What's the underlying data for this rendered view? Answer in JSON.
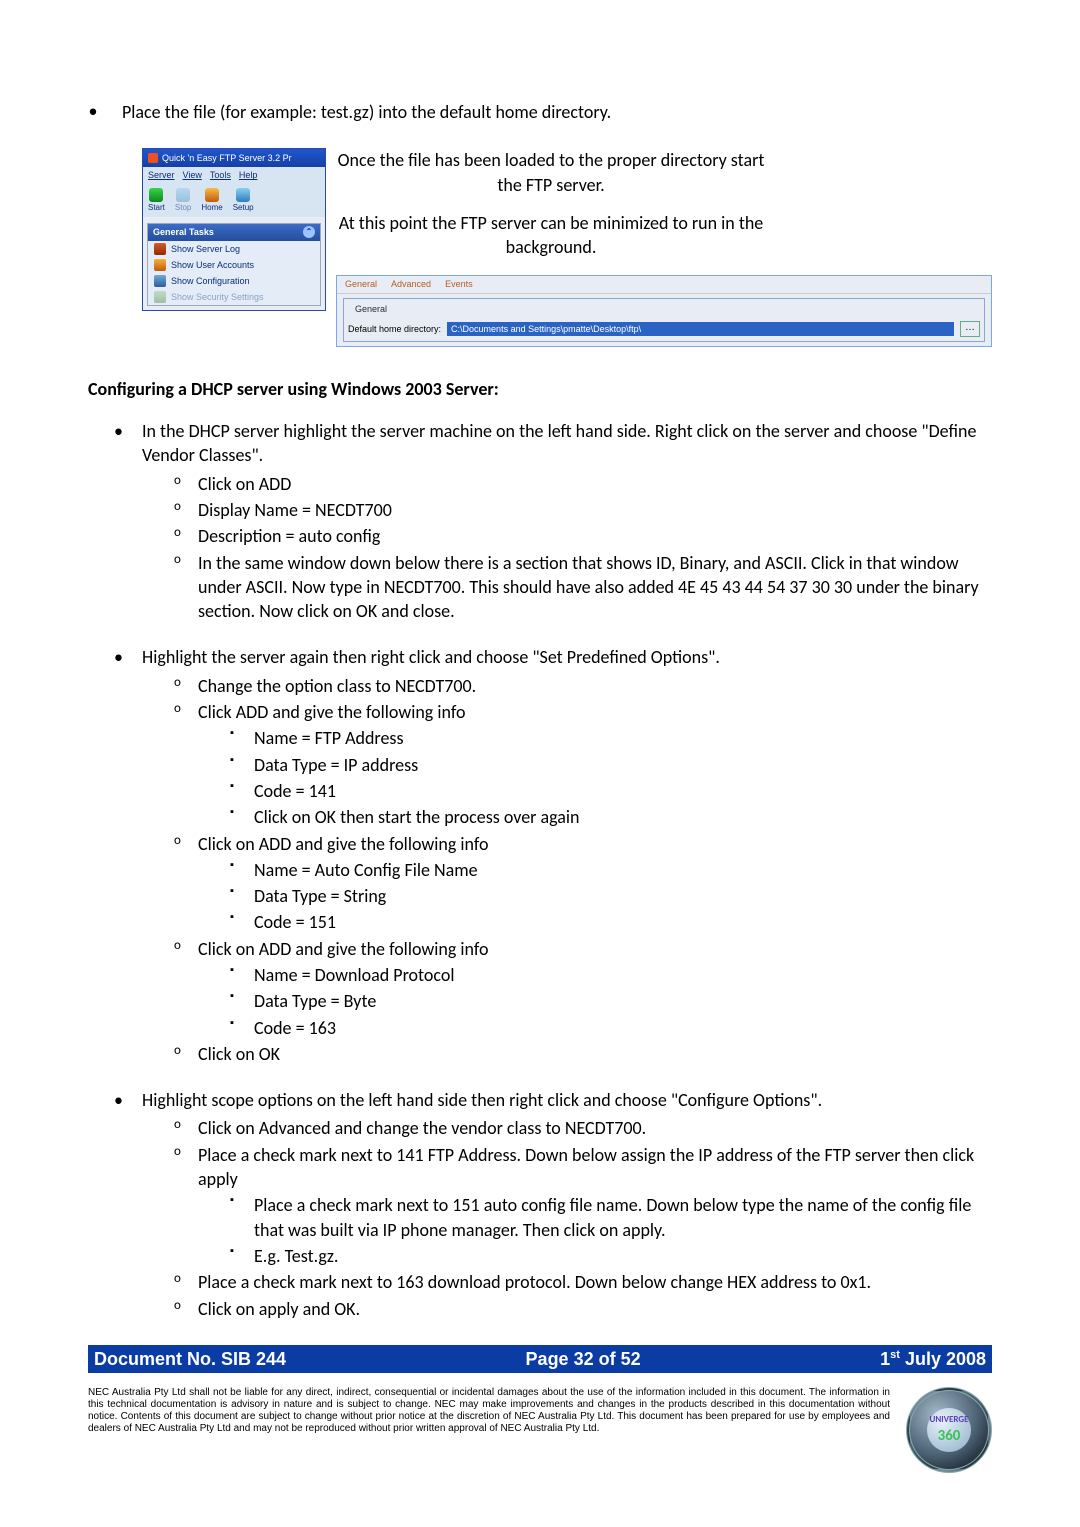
{
  "intro_bullet": "Place the file (for example: test.gz) into the default home directory.",
  "ftp": {
    "title": "Quick 'n Easy FTP Server 3.2 Pr",
    "menu": {
      "server": "Server",
      "view": "View",
      "tools": "Tools",
      "help": "Help"
    },
    "toolbar": {
      "start": "Start",
      "stop": "Stop",
      "home": "Home",
      "setup": "Setup"
    },
    "panel_title": "General Tasks",
    "tasks": {
      "show_server_log": "Show Server Log",
      "show_user_accounts": "Show User Accounts",
      "show_configuration": "Show Configuration",
      "show_security": "Show Security Settings"
    },
    "right_text_1": "Once the file has been loaded to the proper directory start the FTP server.",
    "right_text_2": "At this point the FTP server can be minimized to run in the background.",
    "opts_tabs": {
      "general": "General",
      "advanced": "Advanced",
      "events": "Events"
    },
    "opts_group_title": "General",
    "default_home_label": "Default home directory:",
    "default_home_path": "C:\\Documents and Settings\\pmatte\\Desktop\\ftp\\"
  },
  "heading_dhcp": "Configuring a DHCP server using Windows 2003 Server:",
  "dhcp": {
    "l1_a": "In the DHCP server highlight the server machine on the left hand side.  Right click on the server and choose \"Define Vendor Classes\".",
    "a1": "Click on ADD",
    "a2": "Display Name = NECDT700",
    "a3": "Description = auto config",
    "a4": "In the same window down below there is a section that shows ID, Binary, and ASCII.  Click in that window under ASCII.  Now type in NECDT700.  This should have also added 4E 45 43 44 54 37 30 30 under the binary section.  Now click on OK and close.",
    "l1_b": "Highlight the server again then right click and choose \"Set Predefined Options\".",
    "b1": "Change the option class to NECDT700.",
    "b2": "Click ADD and give the following info",
    "b2_1": "Name = FTP Address",
    "b2_2": "Data Type = IP address",
    "b2_3": "Code = 141",
    "b2_4": "Click on OK then start the process over again",
    "b3": "Click on ADD and give the following info",
    "b3_1": "Name = Auto Config File Name",
    "b3_2": "Data Type = String",
    "b3_3": "Code = 151",
    "b4": "Click on ADD and give the following info",
    "b4_1": "Name = Download Protocol",
    "b4_2": "Data Type = Byte",
    "b4_3": "Code = 163",
    "b5": "Click on OK",
    "l1_c": "Highlight scope options on the left hand side then right click and choose \"Configure Options\".",
    "c1": "Click on Advanced and change the vendor class to NECDT700.",
    "c2": "Place a check mark next to 141 FTP Address.  Down below assign the IP address of the FTP server then click apply",
    "c2_1": "Place a check mark next to 151 auto config file name.  Down below type the name of the config file that was built via IP phone manager.  Then click on apply.",
    "c2_2": "E.g. Test.gz.",
    "c3": "Place a check mark next to 163 download protocol.  Down below change HEX address to 0x1.",
    "c4": "Click on apply and OK."
  },
  "footer": {
    "doc_no": "Document No. SIB 244",
    "page_prefix": "Page ",
    "page_current": "32",
    "page_of": " of ",
    "page_total": "52",
    "date": " July 2008",
    "date_prefix": "1",
    "date_super": "st"
  },
  "disclaimer": "NEC Australia Pty Ltd shall not be liable for any direct, indirect, consequential or incidental damages about the use of the information included in this document. The information in this technical documentation is advisory in nature and is subject to change.  NEC may make improvements and changes in the products described in this documentation without notice.  Contents of this document are subject to change without prior notice at the discretion of NEC Australia Pty Ltd.  This document has been prepared for use by employees and dealers of NEC Australia Pty Ltd and may not be reproduced without prior written approval of NEC Australia Pty Ltd.",
  "logo": {
    "brand": "UNIVERGE",
    "num": "360"
  }
}
